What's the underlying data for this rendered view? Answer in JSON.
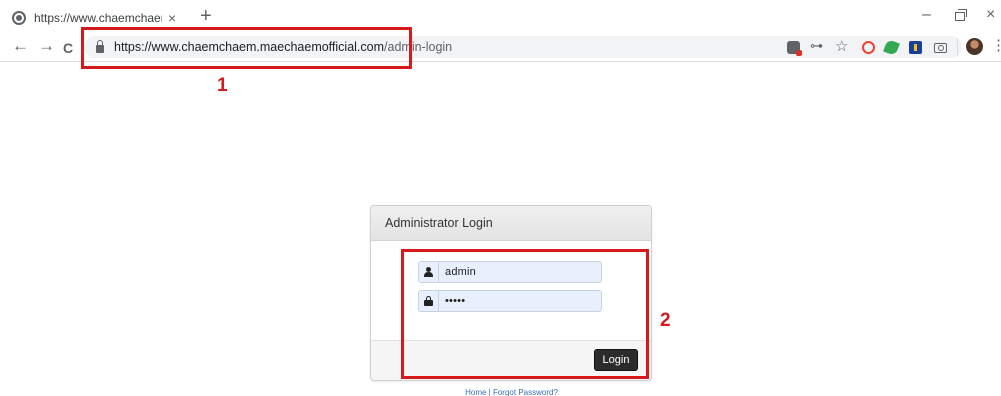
{
  "browser": {
    "tab_title": "https://www.chaemchaem.maec",
    "tab_close": "×",
    "new_tab": "+",
    "window_minimize": "–",
    "window_close": "×",
    "nav_back": "←",
    "nav_forward": "→",
    "nav_reload": "C",
    "url_host": "https://www.chaemchaem.maechaemofficial.com",
    "url_path": "/admin-login",
    "menu": "⋮",
    "icons": [
      "globe-icon",
      "lock-icon",
      "key-icon",
      "star-icon",
      "extension-icons",
      "camera-icon",
      "avatar"
    ]
  },
  "annotations": {
    "label_1": "1",
    "label_2": "2",
    "color": "#d7191c"
  },
  "login": {
    "title": "Administrator Login",
    "username_value": "admin",
    "password_value": "•••••",
    "button_label": "Login"
  },
  "footer": {
    "home": "Home",
    "separator": " | ",
    "forgot": "Forgot Password?"
  }
}
